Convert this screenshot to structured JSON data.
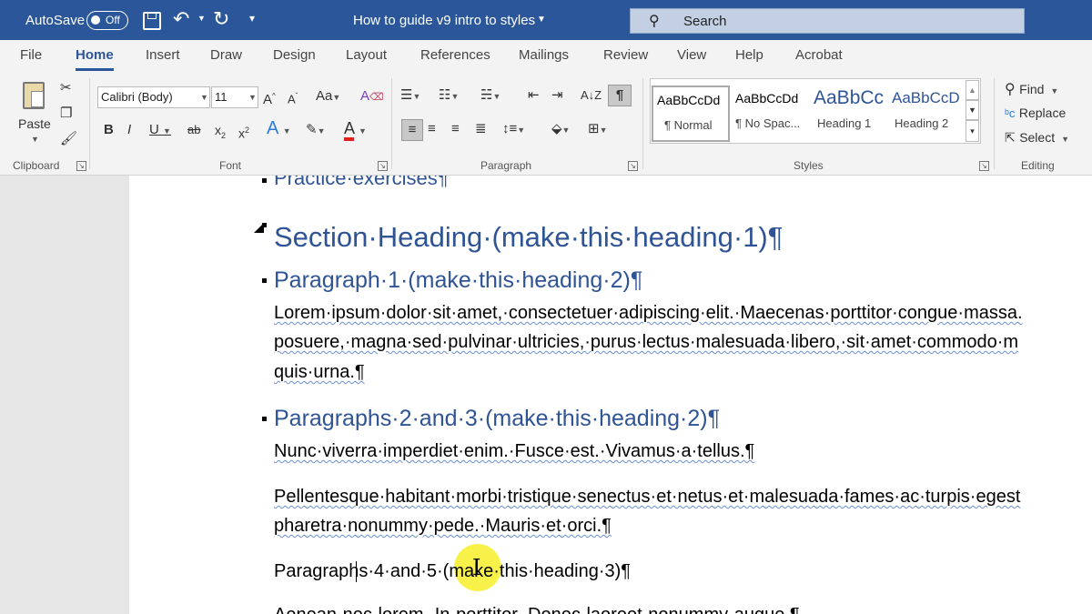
{
  "titlebar": {
    "autosave_label": "AutoSave",
    "autosave_state": "Off",
    "doc_title": "How to guide v9 intro to styles",
    "search_placeholder": "Search"
  },
  "tabs": [
    "File",
    "Home",
    "Insert",
    "Draw",
    "Design",
    "Layout",
    "References",
    "Mailings",
    "Review",
    "View",
    "Help",
    "Acrobat"
  ],
  "ribbon": {
    "clipboard": {
      "paste_label": "Paste",
      "group_label": "Clipboard"
    },
    "font": {
      "font_name": "Calibri (Body)",
      "font_size": "11",
      "group_label": "Font"
    },
    "paragraph": {
      "group_label": "Paragraph"
    },
    "styles": {
      "group_label": "Styles",
      "items": [
        {
          "sample": "AaBbCcDd",
          "name": "¶ Normal",
          "color": "#000000"
        },
        {
          "sample": "AaBbCcDd",
          "name": "¶ No Spac...",
          "color": "#000000"
        },
        {
          "sample": "AaBbCc",
          "name": "Heading 1",
          "color": "#2f5496"
        },
        {
          "sample": "AaBbCcD",
          "name": "Heading 2",
          "color": "#2f5496"
        }
      ]
    },
    "editing": {
      "find_label": "Find",
      "replace_label": "Replace",
      "select_label": "Select",
      "group_label": "Editing"
    }
  },
  "document": {
    "top_partial": "Practice·exercises¶",
    "section_heading": "Section·Heading·(make·this·heading·1)¶",
    "para1_heading": "Paragraph·1·(make·this·heading·2)¶",
    "para1_lines": [
      "Lorem·ipsum·dolor·sit·amet,·consectetuer·adipiscing·elit.·Maecenas·porttitor·congue·massa.",
      "posuere,·magna·sed·pulvinar·ultricies,·purus·lectus·malesuada·libero,·sit·amet·commodo·m",
      "quis·urna.¶"
    ],
    "para23_heading": "Paragraphs·2·and·3·(make·this·heading·2)¶",
    "para2_line": "Nunc·viverra·imperdiet·enim.·Fusce·est.·Vivamus·a·tellus.¶",
    "para3_lines": [
      "Pellentesque·habitant·morbi·tristique·senectus·et·netus·et·malesuada·fames·ac·turpis·egest",
      "pharetra·nonummy·pede.·Mauris·et·orci.¶"
    ],
    "para45_line": "Paragraphs·4·and·5·(make·this·heading·3)¶",
    "bottom_partial": "Aenean·nec·lorem.·In·porttitor.·Donec·laoreet·nonummy·augue.¶"
  },
  "colors": {
    "accent": "#2b579a",
    "heading": "#2f5496",
    "cursor_highlight": "#f7ef2a"
  }
}
